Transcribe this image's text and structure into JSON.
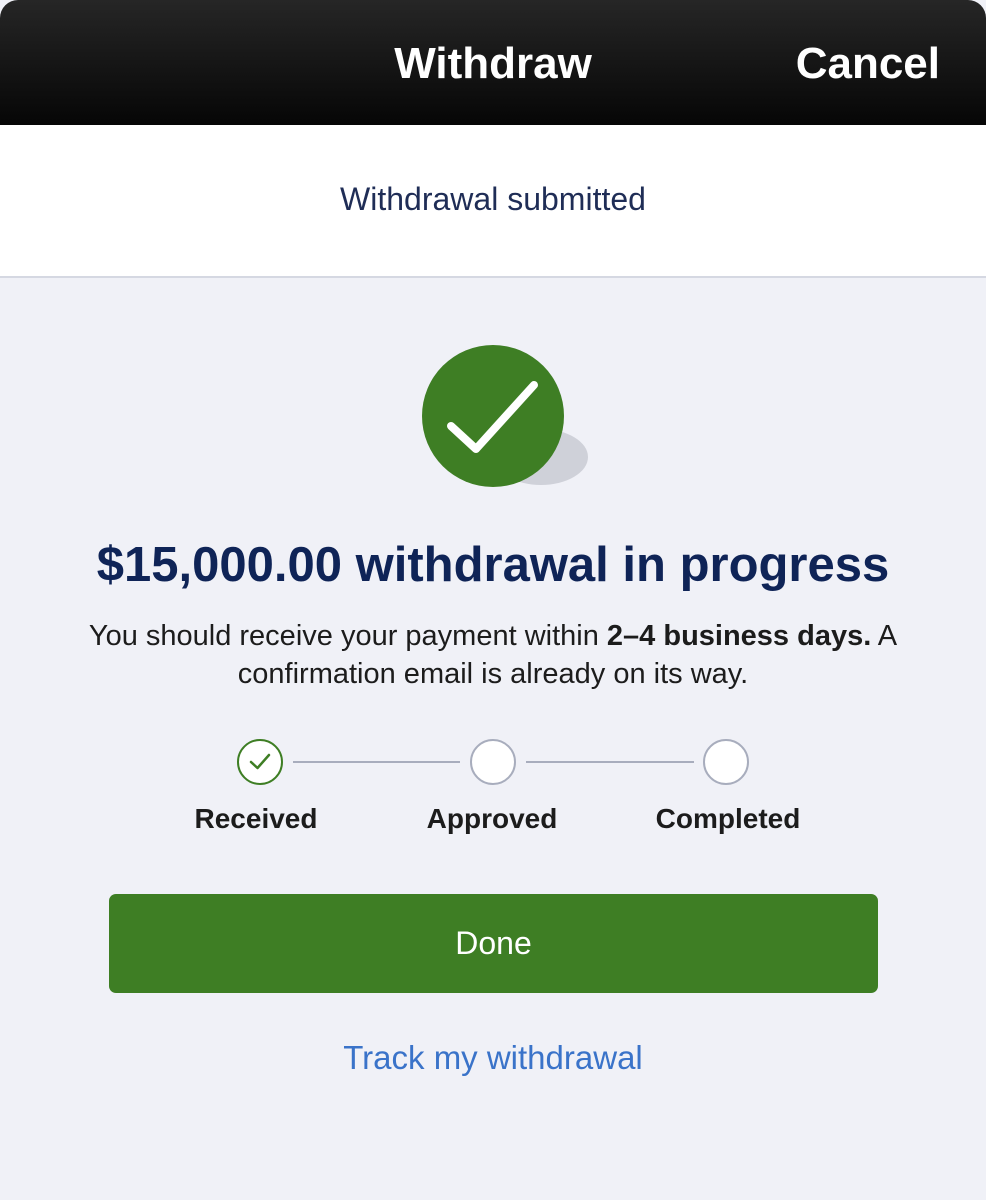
{
  "header": {
    "title": "Withdraw",
    "cancel_label": "Cancel"
  },
  "status": {
    "text": "Withdrawal submitted"
  },
  "confirmation": {
    "headline": "$15,000.00 withdrawal in progress",
    "message_prefix": "You should receive your payment within ",
    "message_bold": "2–4 business days.",
    "message_suffix": " A confirmation email is already on its way."
  },
  "steps": [
    {
      "label": "Received",
      "completed": true
    },
    {
      "label": "Approved",
      "completed": false
    },
    {
      "label": "Completed",
      "completed": false
    }
  ],
  "actions": {
    "done_label": "Done",
    "track_label": "Track my withdrawal"
  },
  "icons": {
    "success": "check-circle-icon",
    "step_done": "check-icon"
  },
  "colors": {
    "accent_green": "#3e7e24",
    "headline_navy": "#0f2457",
    "link_blue": "#3a73c9",
    "background": "#f0f1f7"
  }
}
